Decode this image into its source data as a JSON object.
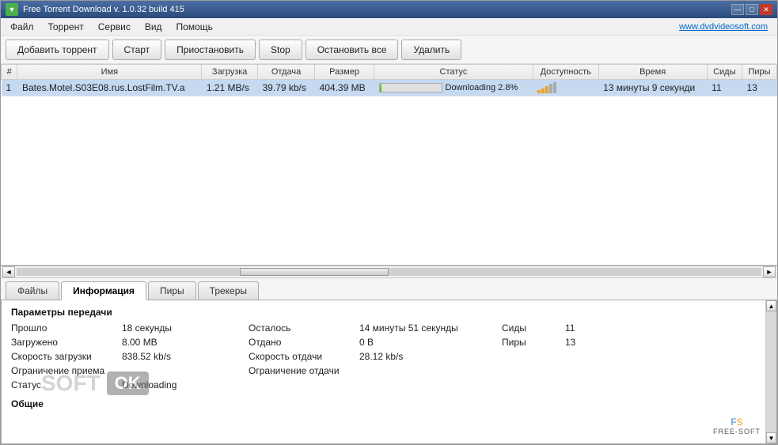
{
  "titleBar": {
    "title": "Free Torrent Download v. 1.0.32 build 415",
    "icon": "FT",
    "controls": [
      "—",
      "□",
      "✕"
    ]
  },
  "menuBar": {
    "items": [
      "Файл",
      "Торрент",
      "Сервис",
      "Вид",
      "Помощь"
    ],
    "link": "www.dvdvideosoft.com"
  },
  "toolbar": {
    "addBtn": "Добавить торрент",
    "startBtn": "Старт",
    "pauseBtn": "Приостановить",
    "stopBtn": "Stop",
    "stopAllBtn": "Остановить все",
    "deleteBtn": "Удалить"
  },
  "tableHeaders": [
    "#",
    "Имя",
    "Загрузка",
    "Отдача",
    "Размер",
    "Статус",
    "Доступность",
    "Время",
    "Сиды",
    "Пиры"
  ],
  "tableRows": [
    {
      "num": "1",
      "name": "Bates.Motel.S03E08.rus.LostFilm.TV.a",
      "download": "1.21 MB/s",
      "upload": "39.79 kb/s",
      "size": "404.39 MB",
      "status": "Downloading 2.8%",
      "progressPct": 2.8,
      "time": "13 минуты 9 секунди",
      "seeds": "11",
      "peers": "13"
    }
  ],
  "tabs": [
    "Файлы",
    "Информация",
    "Пиры",
    "Трекеры"
  ],
  "activeTab": 1,
  "infoPanel": {
    "sectionTitle": "Параметры передачи",
    "rows": [
      {
        "label1": "Прошло",
        "val1": "18 секунды",
        "label2": "Осталось",
        "val2": "14 минуты 51 секунды",
        "label3": "Сиды",
        "val3": "11"
      },
      {
        "label1": "Загружено",
        "val1": "8.00 MB",
        "label2": "Отдано",
        "val2": "0 В",
        "label3": "Пиры",
        "val3": "13"
      },
      {
        "label1": "Скорость загрузки",
        "val1": "838.52 kb/s",
        "label2": "Скорость отдачи",
        "val2": "28.12 kb/s",
        "label3": "",
        "val3": ""
      },
      {
        "label1": "Ограничение приема",
        "val1": "",
        "label2": "Ограничение отдачи",
        "val2": "",
        "label3": "",
        "val3": ""
      },
      {
        "label1": "Статус",
        "val1": "Downloading",
        "label2": "",
        "val2": "",
        "label3": "",
        "val3": ""
      }
    ],
    "generalTitle": "Общие"
  },
  "watermark": {
    "soft": "SOFT",
    "ok": "OK"
  }
}
